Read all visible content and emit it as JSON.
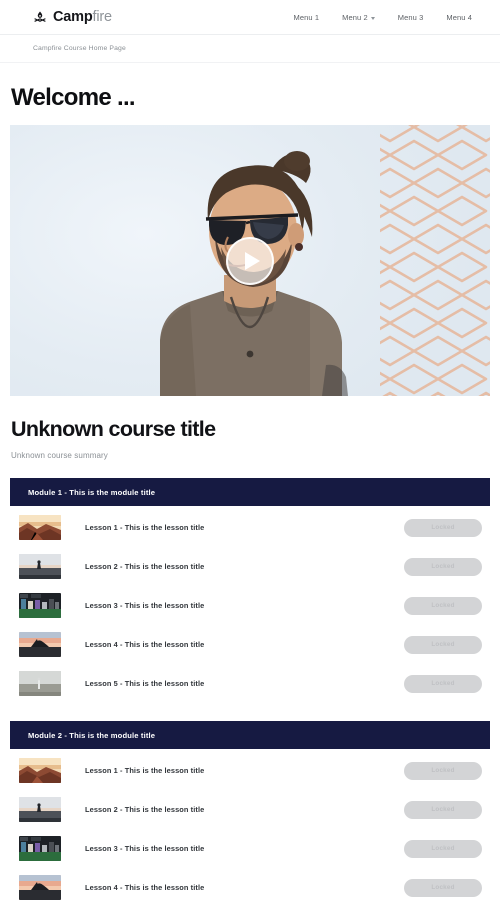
{
  "header": {
    "brand": {
      "icon": "campfire-icon",
      "strong": "Camp",
      "light": "fire"
    },
    "nav": [
      {
        "label": "Menu 1",
        "has_caret": false
      },
      {
        "label": "Menu 2",
        "has_caret": true
      },
      {
        "label": "Menu 3",
        "has_caret": false
      },
      {
        "label": "Menu 4",
        "has_caret": false
      }
    ]
  },
  "breadcrumb": {
    "text": "Campfire Course Home Page"
  },
  "welcome": {
    "title": "Welcome ..."
  },
  "hero": {
    "play_icon": "play-icon",
    "alt": "Man with sunglasses standing in front of copper geometric wall panel"
  },
  "course": {
    "title": "Unknown course title",
    "summary": "Unknown course summary"
  },
  "colors": {
    "module_bar": "#161a42",
    "locked_button": "#d3d4d6",
    "locked_text": "#c0c1c4",
    "brand_strong": "#15161a",
    "brand_light": "#8f9499"
  },
  "modules": [
    {
      "title": "Module 1 - This is the module title",
      "lessons": [
        {
          "title": "Lesson 1 - This is the lesson title",
          "action": "Locked",
          "thumb": "desert-canyon"
        },
        {
          "title": "Lesson 2 - This is the lesson title",
          "action": "Locked",
          "thumb": "lake-dusk"
        },
        {
          "title": "Lesson 3 - This is the lesson title",
          "action": "Locked",
          "thumb": "gym-class"
        },
        {
          "title": "Lesson 4 - This is the lesson title",
          "action": "Locked",
          "thumb": "sunset-yoga"
        },
        {
          "title": "Lesson 5 - This is the lesson title",
          "action": "Locked",
          "thumb": "field-person"
        }
      ]
    },
    {
      "title": "Module 2 - This is the module title",
      "lessons": [
        {
          "title": "Lesson 1 - This is the lesson title",
          "action": "Locked",
          "thumb": "desert-canyon"
        },
        {
          "title": "Lesson 2 - This is the lesson title",
          "action": "Locked",
          "thumb": "lake-dusk"
        },
        {
          "title": "Lesson 3 - This is the lesson title",
          "action": "Locked",
          "thumb": "gym-class"
        },
        {
          "title": "Lesson 4 - This is the lesson title",
          "action": "Locked",
          "thumb": "sunset-yoga"
        }
      ]
    }
  ]
}
